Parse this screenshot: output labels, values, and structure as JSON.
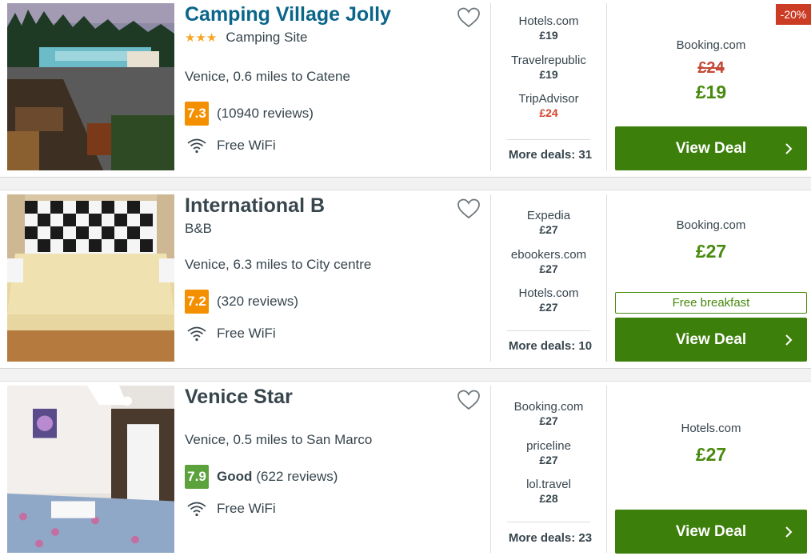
{
  "hotels": [
    {
      "name": "Camping Village Jolly",
      "stars_glyph": "★★★",
      "type": "Camping Site",
      "location": "Venice, 0.6 miles to Catene",
      "score": "7.3",
      "rating_label": "",
      "reviews": "(10940 reviews)",
      "amenity": "Free WiFi",
      "deals": [
        {
          "site": "Hotels.com",
          "price": "£19"
        },
        {
          "site": "Travelrepublic",
          "price": "£19"
        },
        {
          "site": "TripAdvisor",
          "price": "£24"
        }
      ],
      "more_deals": "More deals: 31",
      "discount": "-20%",
      "best_site": "Booking.com",
      "old_price": "£24",
      "best_price": "£19",
      "perk": "",
      "cta": "View Deal"
    },
    {
      "name": "International B",
      "type": "B&B",
      "location": "Venice, 6.3 miles to City centre",
      "score": "7.2",
      "rating_label": "",
      "reviews": "(320 reviews)",
      "amenity": "Free WiFi",
      "deals": [
        {
          "site": "Expedia",
          "price": "£27"
        },
        {
          "site": "ebookers.com",
          "price": "£27"
        },
        {
          "site": "Hotels.com",
          "price": "£27"
        }
      ],
      "more_deals": "More deals: 10",
      "best_site": "Booking.com",
      "best_price": "£27",
      "perk": "Free breakfast",
      "cta": "View Deal"
    },
    {
      "name": "Venice Star",
      "type": "",
      "location": "Venice, 0.5 miles to San Marco",
      "score": "7.9",
      "rating_label": "Good",
      "reviews": "(622 reviews)",
      "amenity": "Free WiFi",
      "deals": [
        {
          "site": "Booking.com",
          "price": "£27"
        },
        {
          "site": "priceline",
          "price": "£27"
        },
        {
          "site": "lol.travel",
          "price": "£28"
        }
      ],
      "more_deals": "More deals: 23",
      "best_site": "Hotels.com",
      "best_price": "£27",
      "perk": "",
      "cta": "View Deal"
    }
  ],
  "colors": {
    "link_blue": "#0a6589",
    "text_dark": "#37454d",
    "score_orange": "#f48f00",
    "score_green": "#5ba23d",
    "price_green": "#478a0d",
    "cta_green": "#3d7f0b",
    "strike_red": "#c34a36",
    "discount_red": "#cc3b23",
    "star_gold": "#f5a623"
  },
  "icons": [
    "heart-icon",
    "wifi-icon",
    "chevron-right-icon",
    "star-icon"
  ]
}
